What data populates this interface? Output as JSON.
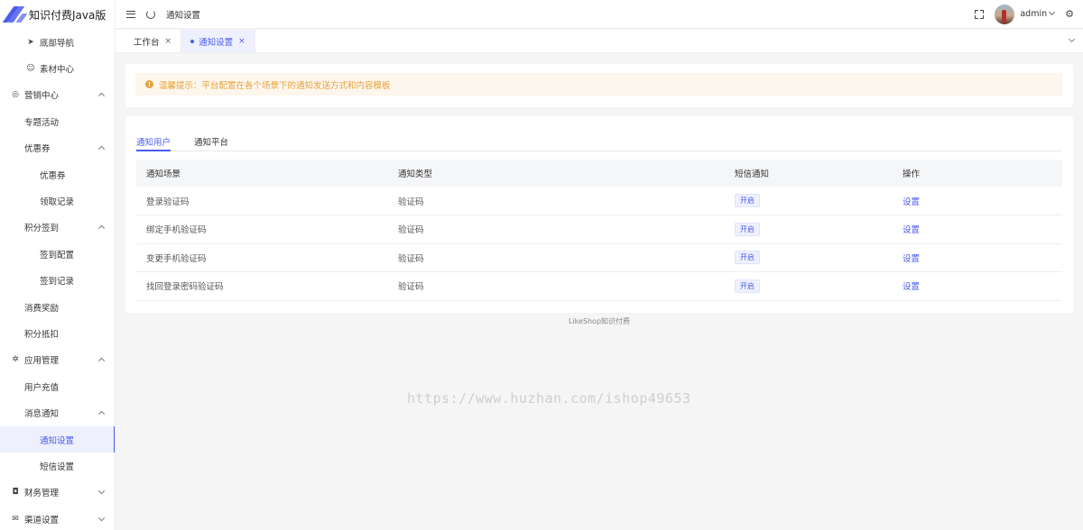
{
  "app": {
    "title": "知识付费Java版"
  },
  "sidebar": {
    "items": [
      {
        "label": "底部导航",
        "icon": "send-icon"
      },
      {
        "label": "素材中心",
        "icon": "smile-icon"
      },
      {
        "label": "营销中心",
        "icon": "target-icon"
      },
      {
        "label": "专题活动"
      },
      {
        "label": "优惠券"
      },
      {
        "label": "优惠券"
      },
      {
        "label": "领取记录"
      },
      {
        "label": "积分签到"
      },
      {
        "label": "签到配置"
      },
      {
        "label": "签到记录"
      },
      {
        "label": "消费奖励"
      },
      {
        "label": "积分抵扣"
      },
      {
        "label": "应用管理",
        "icon": "loader-icon"
      },
      {
        "label": "用户充值"
      },
      {
        "label": "消息通知"
      },
      {
        "label": "通知设置"
      },
      {
        "label": "短信设置"
      },
      {
        "label": "财务管理",
        "icon": "bag-icon"
      },
      {
        "label": "渠道设置",
        "icon": "mail-icon"
      }
    ]
  },
  "header": {
    "breadcrumb": "通知设置",
    "user": "admin"
  },
  "tabs": [
    {
      "label": "工作台",
      "close": "×"
    },
    {
      "label": "通知设置",
      "close": "×"
    }
  ],
  "notice": {
    "text": "温馨提示：平台配置在各个场景下的通知发送方式和内容模板"
  },
  "subtabs": [
    {
      "label": "通知用户"
    },
    {
      "label": "通知平台"
    }
  ],
  "table": {
    "headers": [
      "通知场景",
      "通知类型",
      "短信通知",
      "操作"
    ],
    "rows": [
      {
        "scene": "登录验证码",
        "type": "验证码",
        "sms": "开启",
        "action": "设置"
      },
      {
        "scene": "绑定手机验证码",
        "type": "验证码",
        "sms": "开启",
        "action": "设置"
      },
      {
        "scene": "变更手机验证码",
        "type": "验证码",
        "sms": "开启",
        "action": "设置"
      },
      {
        "scene": "找回登录密码验证码",
        "type": "验证码",
        "sms": "开启",
        "action": "设置"
      }
    ]
  },
  "footer": {
    "text": "LikeShop知识付费"
  },
  "watermark": {
    "text": "https://www.huzhan.com/ishop49653"
  },
  "colors": {
    "accent": "#4b5bef",
    "warning": "#e6a23c",
    "warning_bg": "#fdf6ec"
  }
}
